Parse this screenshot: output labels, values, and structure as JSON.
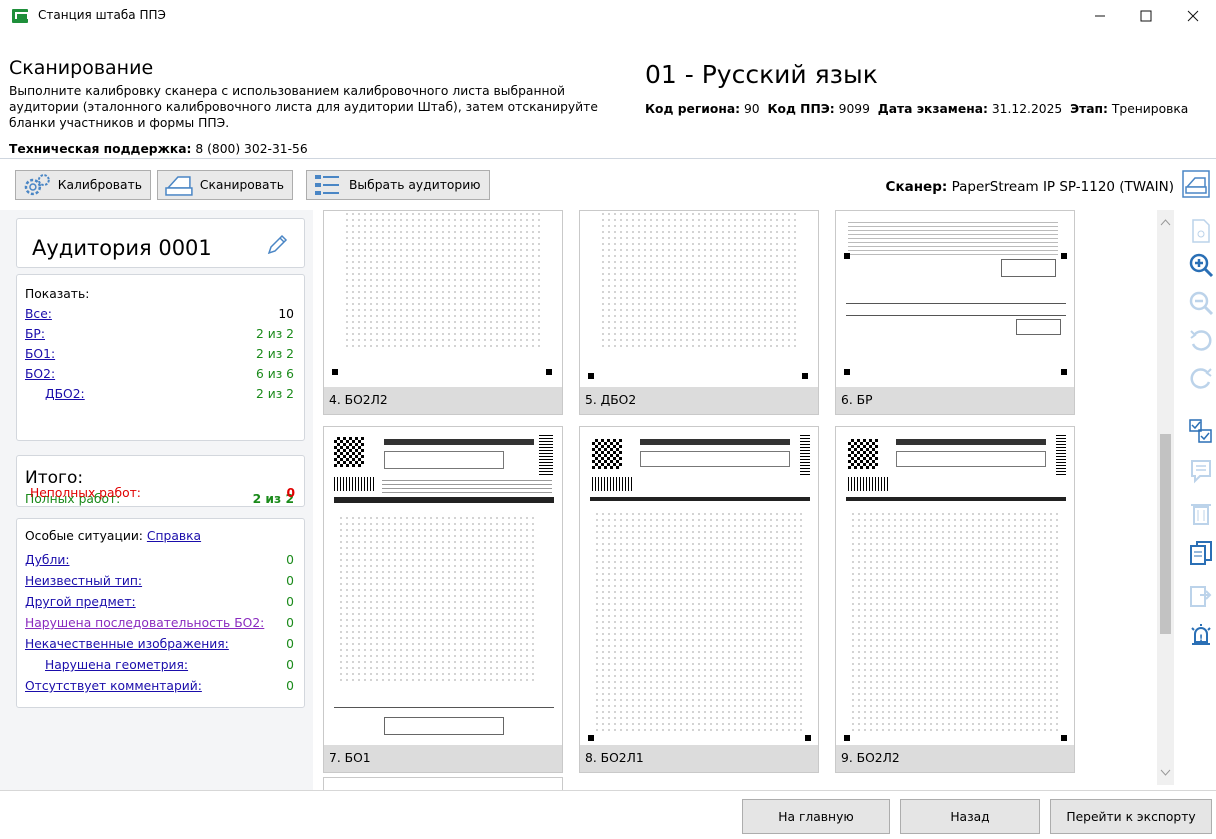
{
  "window": {
    "title": "Станция штаба ППЭ"
  },
  "header": {
    "title": "Сканирование",
    "description": "Выполните калибровку сканера с использованием калибровочного листа выбранной аудитории (эталонного калибровочного листа для аудитории Штаб), затем отсканируйте бланки участников и формы ППЭ.",
    "support_label": "Техническая поддержка:",
    "support_phone": "8 (800) 302-31-56",
    "subject": "01 - Русский язык",
    "region_label": "Код региона:",
    "region_value": "90",
    "ppe_label": "Код ППЭ:",
    "ppe_value": "9099",
    "date_label": "Дата экзамена:",
    "date_value": "31.12.2025",
    "stage_label": "Этап:",
    "stage_value": "Тренировка"
  },
  "toolbar": {
    "calibrate": "Калибровать",
    "scan": "Сканировать",
    "choose_room": "Выбрать аудиторию",
    "scanner_label": "Сканер:",
    "scanner_value": "PaperStream IP SP-1120 (TWAIN)"
  },
  "room": {
    "title": "Аудитория 0001"
  },
  "show": {
    "label": "Показать:",
    "items": [
      {
        "label": "Все:",
        "value": "10"
      },
      {
        "label": "БР:",
        "value": "2 из 2"
      },
      {
        "label": "БО1:",
        "value": "2 из 2"
      },
      {
        "label": "БО2:",
        "value": "6 из 6"
      },
      {
        "label": "ДБО2:",
        "value": "2 из 2"
      }
    ]
  },
  "totals": {
    "title": "Итого:",
    "full_label": "Полных работ:",
    "full_value": "2 из 2",
    "partial_label": "Неполных работ:",
    "partial_value": "0"
  },
  "special": {
    "label": "Особые ситуации:",
    "help": "Справка",
    "items": [
      {
        "label": "Дубли:",
        "value": "0"
      },
      {
        "label": "Неизвестный тип:",
        "value": "0"
      },
      {
        "label": "Другой предмет:",
        "value": "0"
      },
      {
        "label": "Нарушена последовательность БО2:",
        "value": "0"
      },
      {
        "label": "Некачественные изображения:",
        "value": "0"
      },
      {
        "label": "Нарушена геометрия:",
        "value": "0"
      },
      {
        "label": "Отсутствует комментарий:",
        "value": "0"
      }
    ]
  },
  "thumbnails": [
    {
      "caption": "4. БО2Л2"
    },
    {
      "caption": "5. ДБО2"
    },
    {
      "caption": "6. БР"
    },
    {
      "caption": "7. БО1"
    },
    {
      "caption": "8. БО2Л1"
    },
    {
      "caption": "9. БО2Л2"
    }
  ],
  "footer": {
    "home": "На главную",
    "back": "Назад",
    "export": "Перейти к экспорту"
  }
}
